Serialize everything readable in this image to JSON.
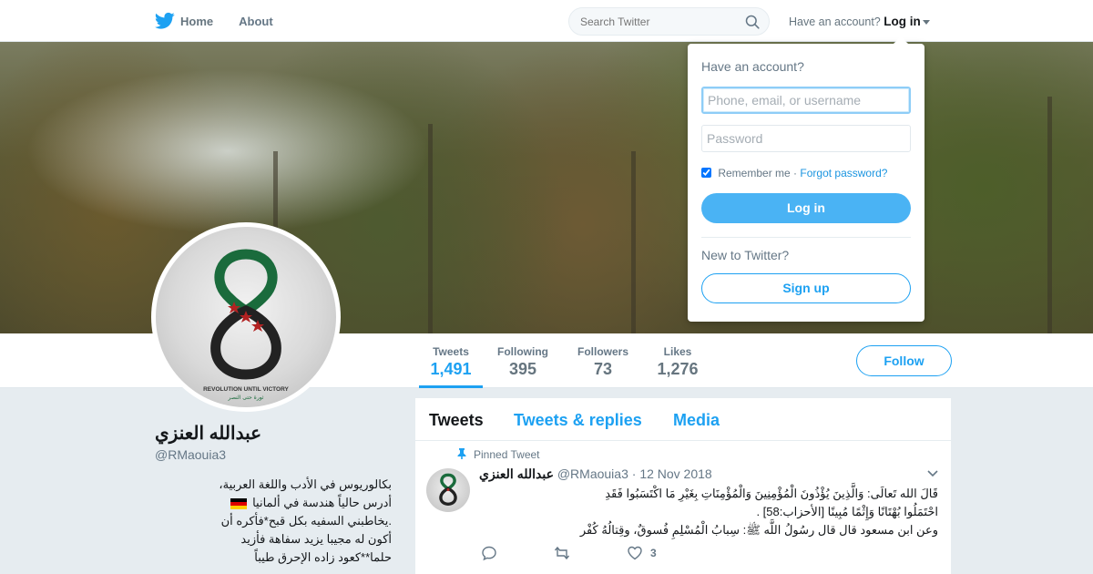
{
  "nav": {
    "home_label": "Home",
    "about_label": "About",
    "search_placeholder": "Search Twitter",
    "have_account": "Have an account?",
    "login_label": "Log in",
    "icons": {
      "logo": "twitter-bird-icon",
      "search": "search-icon",
      "caret": "caret-down-icon"
    },
    "brand_color": "#1da1f2"
  },
  "profile": {
    "name": "عبدالله العنزي",
    "handle": "@RMaouia3",
    "bio_lines": [
      "بكالوريوس في الأدب واللغة العربية،",
      "أدرس حالياً هندسة في ألمانيا",
      ".يخاطبني السفيه بكل قبح*فأكره أن",
      "أكون له مجيبا يزيد سفاهة فأزيد",
      "حلما**كعود زاده الإحرق طيباً"
    ],
    "avatar_text": "REVOLUTION UNTIL VICTORY",
    "avatar_text_ar": "ثورة حتى النصر"
  },
  "stats": [
    {
      "label": "Tweets",
      "value": "1,491",
      "active": true
    },
    {
      "label": "Following",
      "value": "395",
      "active": false
    },
    {
      "label": "Followers",
      "value": "73",
      "active": false
    },
    {
      "label": "Likes",
      "value": "1,276",
      "active": false
    }
  ],
  "follow_label": "Follow",
  "tabs": [
    {
      "label": "Tweets",
      "active": true
    },
    {
      "label": "Tweets & replies",
      "active": false
    },
    {
      "label": "Media",
      "active": false
    }
  ],
  "tweet": {
    "pinned_label": "Pinned Tweet",
    "name": "عبدالله العنزي",
    "handle": "@RMaouia3",
    "dot": "·",
    "date": "12 Nov 2018",
    "lines": [
      "قَالَ الله تَعالَى: وَالَّذِينَ يُؤْذُونَ الْمُؤْمِنِينَ وَالْمُؤْمِنَاتِ بِغَيْرِ مَا اكْتَسَبُوا فَقَدِ",
      "احْتَمَلُوا بُهْتَانًا وَإِثْمًا مُبِينًا [الأحزاب:58] .",
      "وعن ابن مسعود قال قال رسُولُ اللَّه ﷺ: سِبابُ الْمُسْلِمِ فُسوقٌ، وقِتالُهُ كُفْر"
    ],
    "like_count": "3",
    "icons": {
      "pin": "pin-icon",
      "chevron": "chevron-down-icon",
      "reply": "reply-icon",
      "retweet": "retweet-icon",
      "like": "heart-icon"
    }
  },
  "login_dropdown": {
    "title": "Have an account?",
    "username_placeholder": "Phone, email, or username",
    "password_placeholder": "Password",
    "remember_label": "Remember me",
    "separator": "·",
    "forgot_label": "Forgot password?",
    "login_button": "Log in",
    "new_label": "New to Twitter?",
    "signup_button": "Sign up",
    "remember_checked": true
  }
}
